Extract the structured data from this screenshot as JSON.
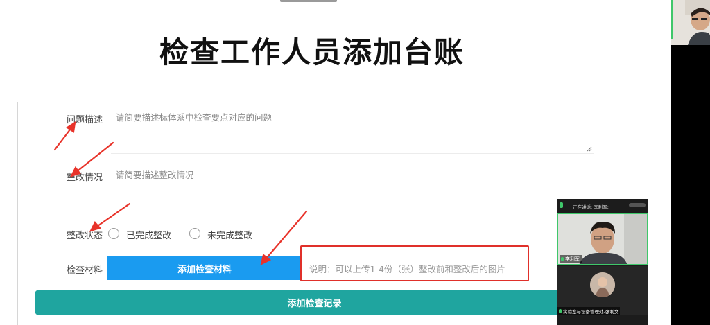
{
  "title": "检查工作人员添加台账",
  "form": {
    "problem": {
      "label": "问题描述",
      "placeholder": "请简要描述标体系中检查要点对应的问题"
    },
    "rectification": {
      "label": "整改情况",
      "placeholder": "请简要描述整改情况"
    },
    "status": {
      "label": "整改状态",
      "options": [
        "已完成整改",
        "未完成整改"
      ]
    },
    "materials": {
      "label": "检查材料",
      "button": "添加检查材料",
      "note": "说明：可以上传1-4份（张）整改前和整改后的图片"
    },
    "submit": "添加检查记录"
  },
  "video_call": {
    "speaking": "正在讲话: 李利军;",
    "participant1": "李利军",
    "participant2": "实验室与设备管理处-张利文"
  },
  "colors": {
    "primary_button": "#1a9bf0",
    "submit_button": "#1fa59f",
    "annotation_red": "#e0302a",
    "active_speaker": "#3fc76a"
  }
}
